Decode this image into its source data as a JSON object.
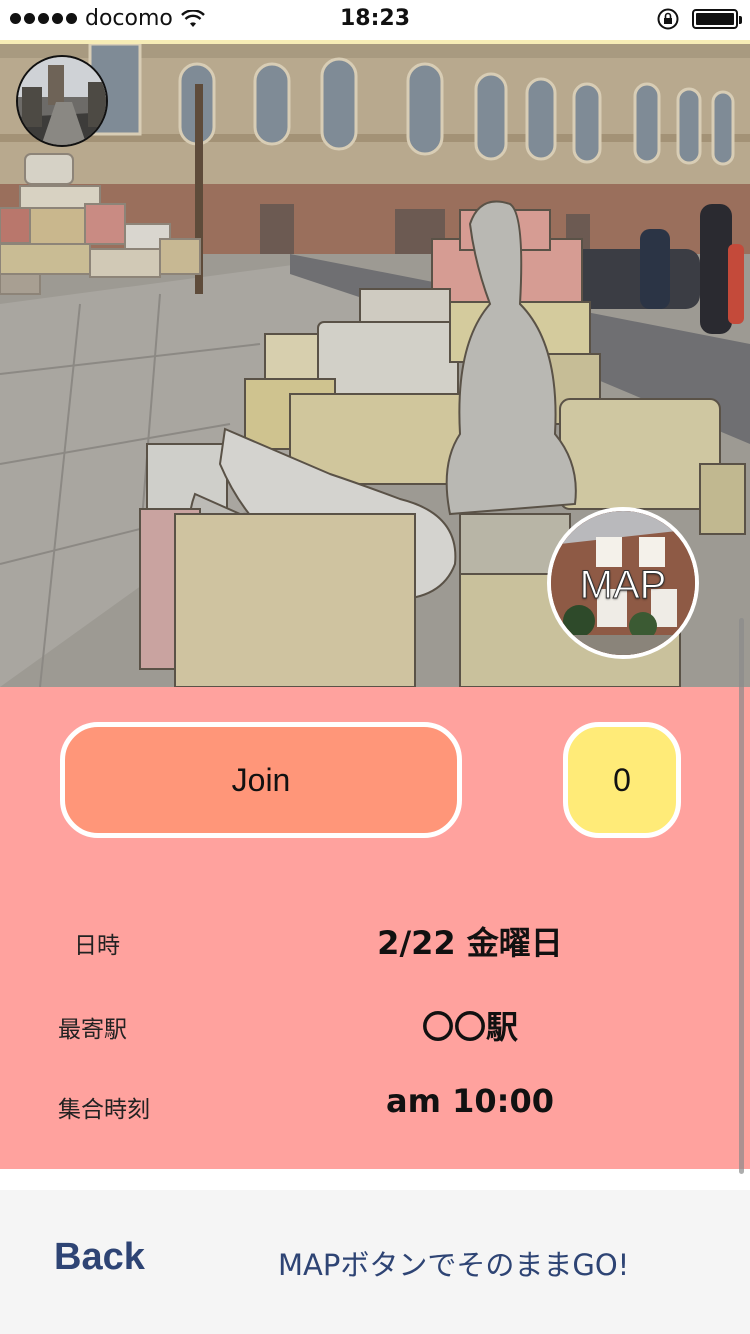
{
  "status_bar": {
    "carrier": "docomo",
    "time": "18:23",
    "icons": [
      "signal-dots-icon",
      "wifi-icon",
      "rotation-lock-icon",
      "battery-icon"
    ]
  },
  "hero": {
    "map_button_label": "MAP"
  },
  "actions": {
    "join_label": "Join",
    "participant_count": "0"
  },
  "details": [
    {
      "label": "日時",
      "value": "2/22 金曜日"
    },
    {
      "label": "最寄駅",
      "value": "〇〇駅"
    },
    {
      "label": "集合時刻",
      "value": "am 10:00"
    }
  ],
  "bottom_bar": {
    "back_label": "Back",
    "hint": "MAPボタンでそのままGO!"
  },
  "colors": {
    "panel": "#ffa29e",
    "join_button": "#ff9679",
    "count_badge": "#ffeb78",
    "bottom_text": "#2e4474"
  }
}
